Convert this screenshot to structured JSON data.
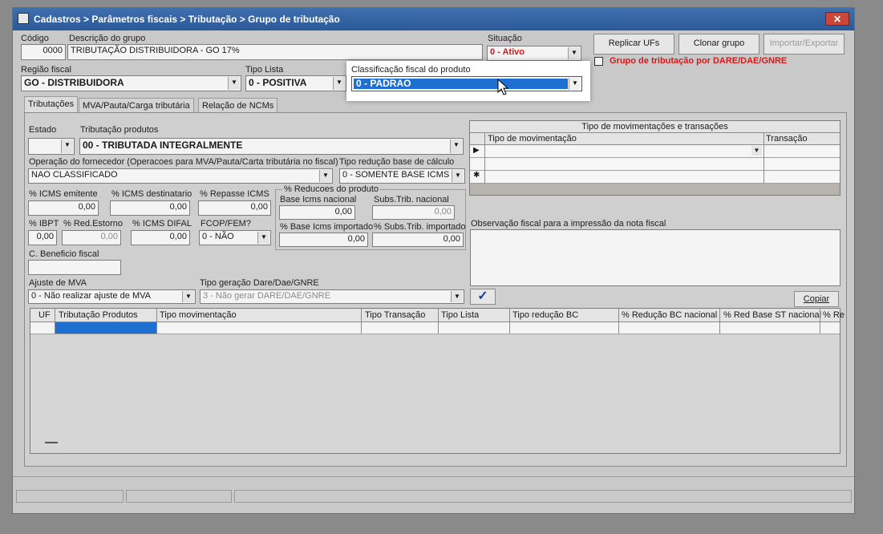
{
  "window": {
    "title": "Cadastros > Parâmetros fiscais > Tributação > Grupo de tributação",
    "close_label": "✕"
  },
  "header": {
    "codigo_label": "Código",
    "codigo_value": "0000",
    "descricao_label": "Descrição do grupo",
    "descricao_value": "TRIBUTAÇÃO DISTRIBUIDORA - GO 17%",
    "situacao_label": "Situação",
    "situacao_value": "0 - Ativo",
    "regiao_label": "Região fiscal",
    "regiao_value": "GO - DISTRIBUIDORA",
    "tipo_lista_label": "Tipo Lista",
    "tipo_lista_value": "0 - POSITIVA",
    "classificacao_label": "Classificação fiscal do produto",
    "classificacao_value": "0 - PADRAO",
    "replicar_label": "Replicar UFs",
    "clonar_label": "Clonar grupo",
    "importar_label": "Importar/Exportar",
    "dare_label": "Grupo de tributação por DARE/DAE/GNRE"
  },
  "tabs": [
    {
      "label": "Tributações"
    },
    {
      "label": "MVA/Pauta/Carga tributária"
    },
    {
      "label": "Relação de NCMs"
    }
  ],
  "form": {
    "estado_label": "Estado",
    "estado_value": "",
    "trib_produtos_label": "Tributação produtos",
    "trib_produtos_value": "00 - TRIBUTADA INTEGRALMENTE",
    "operacao_label": "Operação do fornecedor (Operacoes para MVA/Pauta/Carta tributária no fiscal)",
    "operacao_value": "NAO CLASSIFICADO",
    "tipo_reducao_label": "Tipo redução base de cálculo",
    "tipo_reducao_value": "0 - SOMENTE BASE ICMS",
    "icms_emitente_label": "% ICMS emitente",
    "icms_emitente_value": "0,00",
    "icms_destinatario_label": "% ICMS destinatario",
    "icms_destinatario_value": "0,00",
    "repasse_icms_label": "% Repasse ICMS",
    "repasse_icms_value": "0,00",
    "reducoes_label": "% Reducoes do produto",
    "base_icms_nacional_label": "Base Icms nacional",
    "base_icms_nacional_value": "0,00",
    "subs_trib_nacional_label": "Subs.Trib. nacional",
    "subs_trib_nacional_value": "0,00",
    "ibpt_label": "% IBPT",
    "ibpt_value": "0,00",
    "red_estorno_label": "% Red.Estorno",
    "red_estorno_value": "0,00",
    "icms_difal_label": "% ICMS DIFAL",
    "icms_difal_value": "0,00",
    "fcop_label": "FCOP/FEM?",
    "fcop_value": "0 - NÃO",
    "base_icms_importado_label": "% Base Icms importado",
    "base_icms_importado_value": "0,00",
    "subs_trib_importado_label": "% Subs.Trib. importado",
    "subs_trib_importado_value": "0,00",
    "beneficio_label": "C. Beneficio fiscal",
    "beneficio_value": "",
    "ajuste_mva_label": "Ajuste de MVA",
    "ajuste_mva_value": "0 - Não realizar ajuste de MVA",
    "tipo_geracao_label": "Tipo geração Dare/Dae/GNRE",
    "tipo_geracao_value": "3 - Não gerar DARE/DAE/GNRE",
    "confirm_icon": "✓",
    "copiar_label": "Copiar"
  },
  "mov_grid": {
    "title": "Tipo de movimentações e transações",
    "col_tipo": "Tipo de movimentação",
    "col_transacao": "Transação"
  },
  "observacao": {
    "label": "Observação fiscal para a impressão da nota fiscal",
    "value": ""
  },
  "main_grid": {
    "columns": [
      "UF",
      "Tributação Produtos",
      "Tipo movimentação",
      "Tipo Transação",
      "Tipo Lista",
      "Tipo redução BC",
      "% Redução BC nacional",
      "% Red Base ST nacional",
      "% Re"
    ]
  }
}
